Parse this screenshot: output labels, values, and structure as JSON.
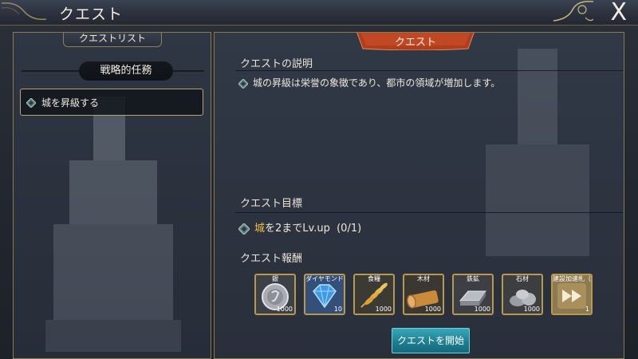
{
  "window": {
    "title": "クエスト",
    "close_label": "X"
  },
  "quest_list": {
    "header": "クエストリスト",
    "category": "戦略的任務",
    "items": [
      {
        "label": "城を昇級する",
        "selected": true
      }
    ]
  },
  "quest_detail": {
    "tab_label": "クエスト",
    "description_title": "クエストの説明",
    "description_text": "城の昇級は栄誉の象徴であり、都市の領域が増加します。",
    "goal_title": "クエスト目標",
    "goal": {
      "highlight": "城",
      "text": "を2までLv.up",
      "progress": "(0/1)"
    },
    "reward_title": "クエスト報酬",
    "rewards": [
      {
        "name": "銀",
        "count": "1000",
        "icon": "silver-coin-icon"
      },
      {
        "name": "ダイヤモンド",
        "count": "10",
        "icon": "diamond-icon"
      },
      {
        "name": "食糧",
        "count": "1000",
        "icon": "wheat-icon"
      },
      {
        "name": "木材",
        "count": "1000",
        "icon": "wood-log-icon"
      },
      {
        "name": "鉄鉱",
        "count": "1000",
        "icon": "iron-ingot-icon"
      },
      {
        "name": "石材",
        "count": "1000",
        "icon": "stone-icon"
      },
      {
        "name": "建設加速札（",
        "count": "1",
        "icon": "speedup-icon"
      }
    ],
    "start_button": "クエストを開始"
  },
  "colors": {
    "accent_gold": "#b89a4c",
    "highlight_yellow": "#f1c040",
    "tab_orange": "#c2441e",
    "button_teal": "#1e7f93"
  }
}
